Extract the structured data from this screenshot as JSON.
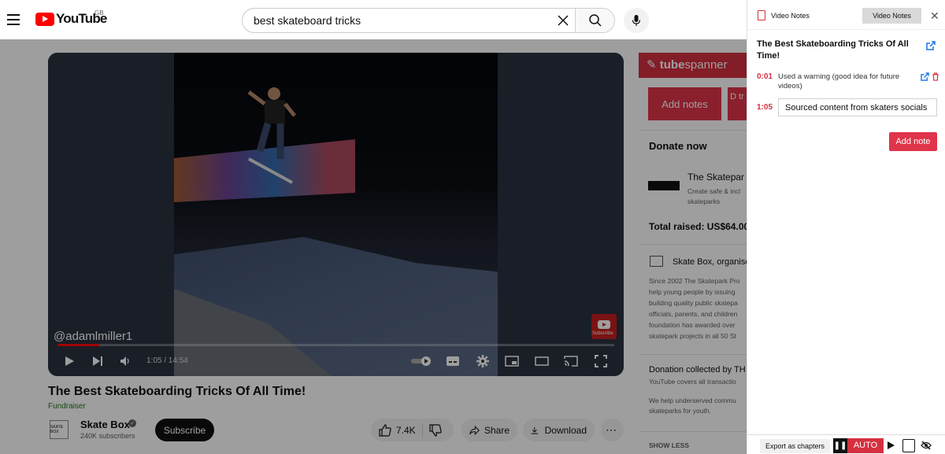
{
  "header": {
    "logo_text": "YouTube",
    "country_code": "GB",
    "search_value": "best skateboard tricks"
  },
  "player": {
    "watermark": "@adamlmiller1",
    "subscribe_watermark": "Subscribe",
    "time": "1:05 / 14:54",
    "progress": 0.075
  },
  "video": {
    "title": "The Best Skateboarding Tricks Of All Time!",
    "badge": "Fundraiser",
    "channel": {
      "avatar_text": "SKATE BOX",
      "name": "Skate Box",
      "subscribers": "240K subscribers",
      "subscribe_label": "Subscribe"
    },
    "actions": {
      "likes": "7.4K",
      "share": "Share",
      "download": "Download",
      "more": "⋯"
    }
  },
  "right_column": {
    "tubespanner_prefix": "tube",
    "tubespanner_suffix": "spanner",
    "add_notes": "Add notes",
    "d_button": "D tr",
    "donate_heading": "Donate now",
    "donor_name": "The Skatepar",
    "donor_desc": "Create safe & incl skateparks",
    "total_raised": "Total raised: US$64.00",
    "org_name": "Skate Box",
    "org_suffix": ", organise",
    "org_desc": "Since 2002 The Skatepark Pro help young people by issuing building quality public skatepa officials, parents, and children foundation has awarded over skatepark projects in all 50 St",
    "collected": "Donation collected by TH",
    "covers": "YouTube covers all transactio",
    "help": "We help underserved commu skateparks for youth.",
    "show_less": "SHOW LESS"
  },
  "notes_panel": {
    "title": "Video Notes",
    "tab_label": "Video Notes",
    "video_title": "The Best Skateboarding Tricks Of All Time!",
    "notes": [
      {
        "timestamp": "0:01",
        "text": "Used a warning (good idea for future videos)"
      },
      {
        "timestamp": "1:05",
        "text": "Sourced content from skaters socials"
      }
    ],
    "add_note_label": "Add note",
    "export_label": "Export as chapters",
    "auto_label": "AUTO"
  },
  "colors": {
    "youtube_red": "#ff0000",
    "accent_red": "#e0344a",
    "timestamp_red": "#d4303f"
  }
}
